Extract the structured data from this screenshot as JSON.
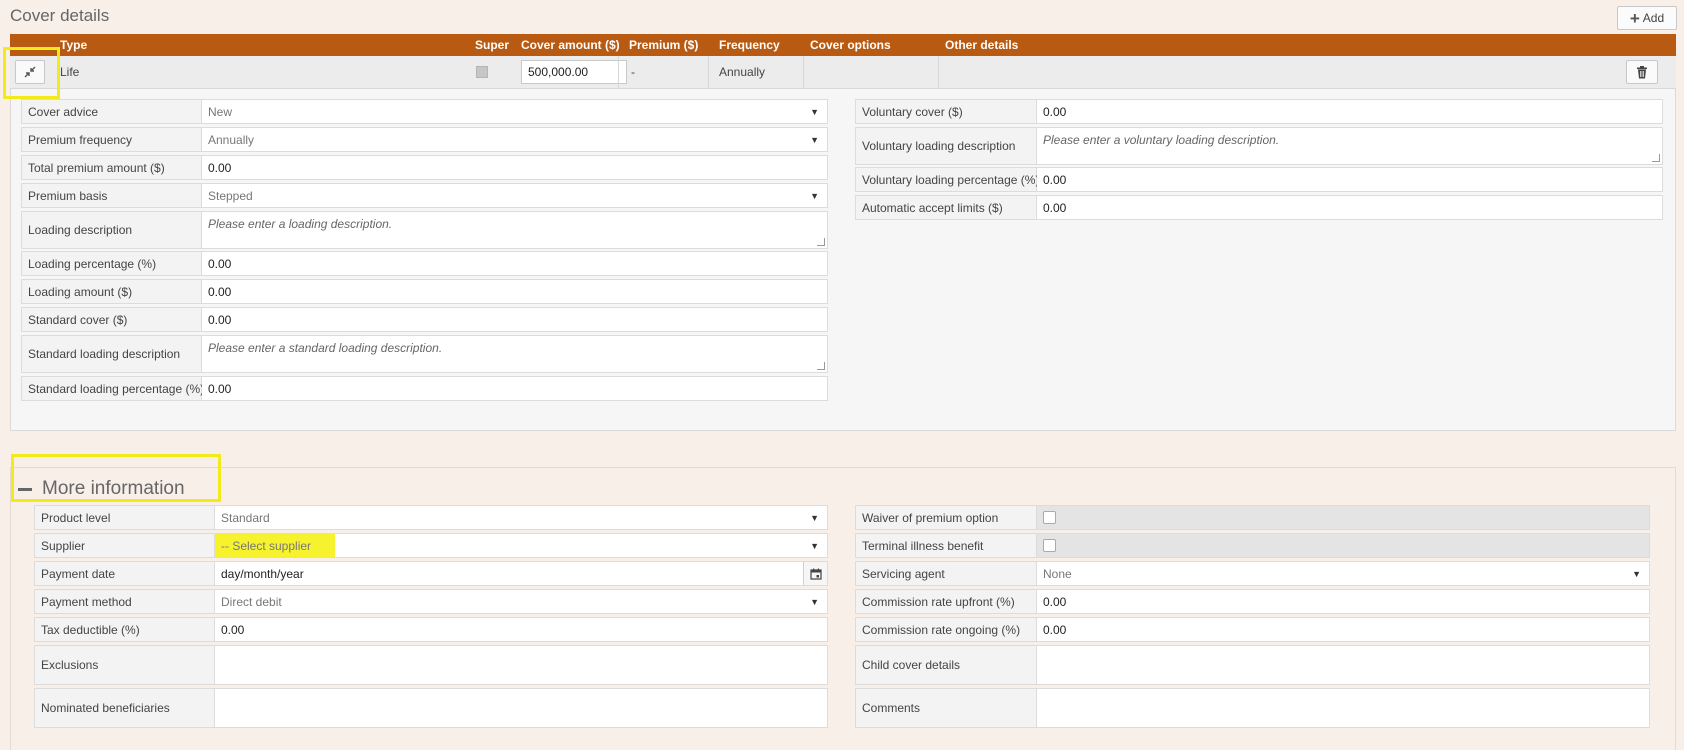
{
  "page_title": "Cover details",
  "add_label": "Add",
  "cover_table": {
    "headers": {
      "type": "Type",
      "super": "Super",
      "cover_amount": "Cover amount ($)",
      "premium": "Premium ($)",
      "frequency": "Frequency",
      "cover_options": "Cover options",
      "other_details": "Other details"
    },
    "row": {
      "type": "Life",
      "cover_amount": "500,000.00",
      "premium": "-",
      "frequency": "Annually"
    }
  },
  "cover_detail_left": {
    "cover_advice": {
      "label": "Cover advice",
      "value": "New"
    },
    "premium_frequency": {
      "label": "Premium frequency",
      "value": "Annually"
    },
    "total_premium": {
      "label": "Total premium amount ($)",
      "value": "0.00"
    },
    "premium_basis": {
      "label": "Premium basis",
      "value": "Stepped"
    },
    "loading_description": {
      "label": "Loading description",
      "placeholder": "Please enter a loading description."
    },
    "loading_percentage": {
      "label": "Loading percentage (%)",
      "value": "0.00"
    },
    "loading_amount": {
      "label": "Loading amount ($)",
      "value": "0.00"
    },
    "standard_cover": {
      "label": "Standard cover ($)",
      "value": "0.00"
    },
    "standard_loading_description": {
      "label": "Standard loading description",
      "placeholder": "Please enter a standard loading description."
    },
    "standard_loading_percentage": {
      "label": "Standard loading percentage (%)",
      "value": "0.00"
    }
  },
  "cover_detail_right": {
    "voluntary_cover": {
      "label": "Voluntary cover ($)",
      "value": "0.00"
    },
    "voluntary_loading_description": {
      "label": "Voluntary loading description",
      "placeholder": "Please enter a voluntary loading description."
    },
    "voluntary_loading_percentage": {
      "label": "Voluntary loading percentage (%)",
      "value": "0.00"
    },
    "automatic_accept_limits": {
      "label": "Automatic accept limits ($)",
      "value": "0.00"
    }
  },
  "more_information": {
    "title": "More information",
    "left": {
      "product_level": {
        "label": "Product level",
        "value": "Standard"
      },
      "supplier": {
        "label": "Supplier",
        "value": "-- Select supplier"
      },
      "payment_date": {
        "label": "Payment date",
        "value": "day/month/year"
      },
      "payment_method": {
        "label": "Payment method",
        "value": "Direct debit"
      },
      "tax_deductible": {
        "label": "Tax deductible (%)",
        "value": "0.00"
      },
      "exclusions": {
        "label": "Exclusions",
        "value": ""
      },
      "nominated_beneficiaries": {
        "label": "Nominated beneficiaries",
        "value": ""
      }
    },
    "right": {
      "waiver_of_premium": {
        "label": "Waiver of premium option"
      },
      "terminal_illness": {
        "label": "Terminal illness benefit"
      },
      "servicing_agent": {
        "label": "Servicing agent",
        "value": "None"
      },
      "commission_upfront": {
        "label": "Commission rate upfront (%)",
        "value": "0.00"
      },
      "commission_ongoing": {
        "label": "Commission rate ongoing (%)",
        "value": "0.00"
      },
      "child_cover_details": {
        "label": "Child cover details",
        "value": ""
      },
      "comments": {
        "label": "Comments",
        "value": ""
      }
    }
  },
  "colors": {
    "header_bg": "#b85a12",
    "highlight": "#f2ea1a",
    "page_bg": "#f8efe9"
  }
}
